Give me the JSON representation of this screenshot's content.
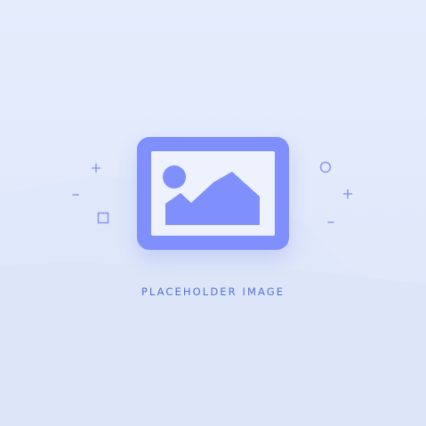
{
  "placeholder": {
    "caption": "PLACEHOLDER IMAGE",
    "icon": "image-icon"
  },
  "decorations": {
    "plus_icon": "plus-icon",
    "minus_icon": "minus-icon",
    "circle_icon": "circle-outline-icon",
    "square_icon": "square-outline-icon"
  },
  "colors": {
    "background": "#e2eafc",
    "accent": "#7f8ffc",
    "caption_text": "#5670d8",
    "frame_inner": "#eef2fe"
  }
}
